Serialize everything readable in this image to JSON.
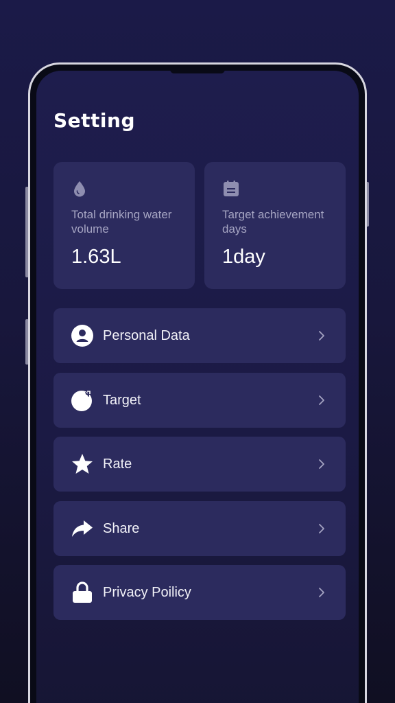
{
  "page": {
    "title": "Setting"
  },
  "stats": [
    {
      "icon": "water-drop-icon",
      "label": "Total drinking water volume",
      "value": "1.63L"
    },
    {
      "icon": "calendar-icon",
      "label": "Target achievement days",
      "value": "1day"
    }
  ],
  "menu": [
    {
      "label": "Personal Data",
      "icon": "user-icon"
    },
    {
      "label": "Target",
      "icon": "target-icon"
    },
    {
      "label": "Rate",
      "icon": "star-icon"
    },
    {
      "label": "Share",
      "icon": "share-arrow-icon"
    },
    {
      "label": "Privacy Poilicy",
      "icon": "lock-icon"
    }
  ],
  "colors": {
    "card": "#2c2b5e",
    "background": "#1e1d4d",
    "text": "#ffffff",
    "muted": "#a5a4c2"
  }
}
